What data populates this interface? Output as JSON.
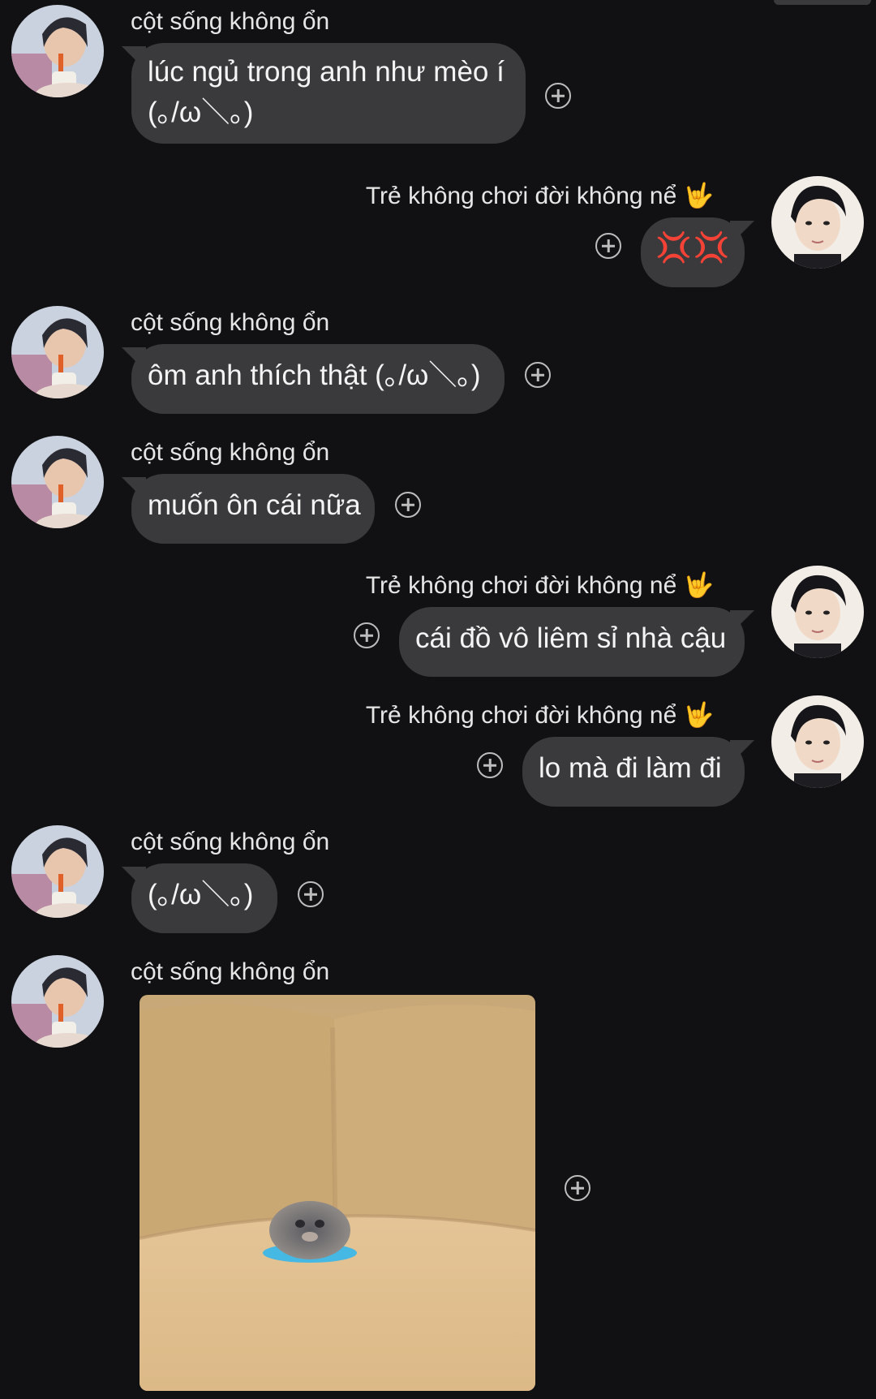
{
  "senders": {
    "left": "cột sống không ổn",
    "right": "Trẻ không chơi đời không nể",
    "right_emoji": "🤟"
  },
  "messages": [
    {
      "side": "left",
      "text": "lúc ngủ trong anh như mèo í\n(｡/ω＼｡)"
    },
    {
      "side": "right",
      "text": "💢💢"
    },
    {
      "side": "left",
      "text": "ôm anh thích thật (｡/ω＼｡)"
    },
    {
      "side": "left",
      "text": "muốn ôn cái nữa"
    },
    {
      "side": "right",
      "text": "cái đồ vô liêm sỉ nhà cậu"
    },
    {
      "side": "right",
      "text": "lo mà đi làm đi"
    },
    {
      "side": "left",
      "text": "(｡/ω＼｡)"
    },
    {
      "side": "left",
      "type": "image",
      "image": "hamster-on-beige-sofa"
    }
  ],
  "icons": {
    "react": "add-reaction-icon"
  },
  "colors": {
    "background": "#111113",
    "bubble": "#3a3a3c",
    "text": "#f4f4f4"
  }
}
